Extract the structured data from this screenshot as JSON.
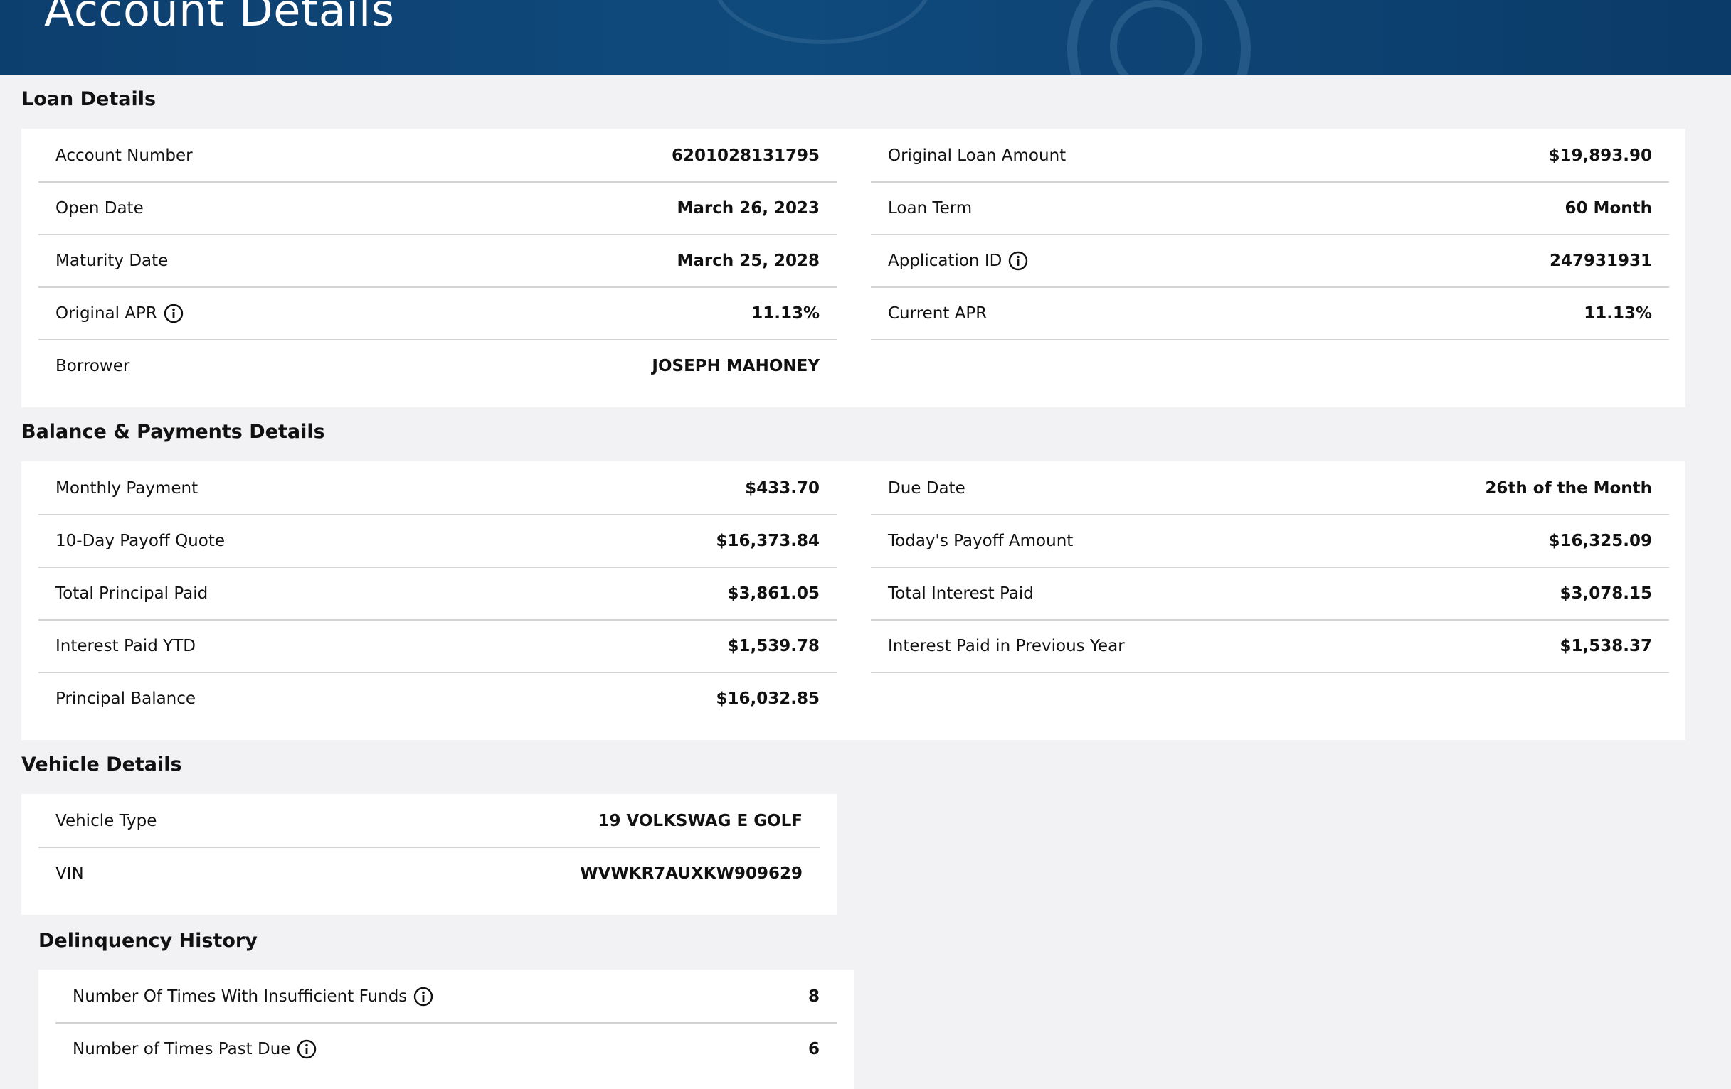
{
  "header": {
    "title": "Account Details"
  },
  "loan": {
    "title": "Loan Details",
    "left": [
      {
        "label": "Account Number",
        "value": "6201028131795"
      },
      {
        "label": "Open Date",
        "value": "March 26, 2023"
      },
      {
        "label": "Maturity Date",
        "value": "March 25, 2028"
      },
      {
        "label": "Original APR",
        "value": "11.13%"
      },
      {
        "label": "Borrower",
        "value": "JOSEPH MAHONEY"
      }
    ],
    "right": [
      {
        "label": "Original Loan Amount",
        "value": "$19,893.90"
      },
      {
        "label": "Loan Term",
        "value": "60 Month"
      },
      {
        "label": "Application ID",
        "value": "247931931"
      },
      {
        "label": "Current APR",
        "value": "11.13%"
      }
    ]
  },
  "balance": {
    "title": "Balance & Payments Details",
    "left": [
      {
        "label": "Monthly Payment",
        "value": "$433.70"
      },
      {
        "label": "10-Day Payoff Quote",
        "value": "$16,373.84"
      },
      {
        "label": "Total Principal Paid",
        "value": "$3,861.05"
      },
      {
        "label": "Interest Paid YTD",
        "value": "$1,539.78"
      },
      {
        "label": "Principal Balance",
        "value": "$16,032.85"
      }
    ],
    "right": [
      {
        "label": "Due Date",
        "value": "26th of the Month"
      },
      {
        "label": "Today's Payoff Amount",
        "value": "$16,325.09"
      },
      {
        "label": "Total Interest Paid",
        "value": "$3,078.15"
      },
      {
        "label": "Interest Paid in Previous Year",
        "value": "$1,538.37"
      }
    ]
  },
  "vehicle": {
    "title": "Vehicle Details",
    "rows": [
      {
        "label": "Vehicle Type",
        "value": "19 VOLKSWAG E GOLF"
      },
      {
        "label": "VIN",
        "value": "WVWKR7AUXKW909629"
      }
    ]
  },
  "delinquency": {
    "title": "Delinquency History",
    "rows": [
      {
        "label": "Number Of Times With Insufficient Funds",
        "value": "8"
      },
      {
        "label": "Number of Times Past Due",
        "value": "6"
      }
    ]
  },
  "colors": {
    "banner": "#0f4a7d",
    "background": "#f2f1f4",
    "card": "#ffffff",
    "divider": "#d3d3d6"
  }
}
